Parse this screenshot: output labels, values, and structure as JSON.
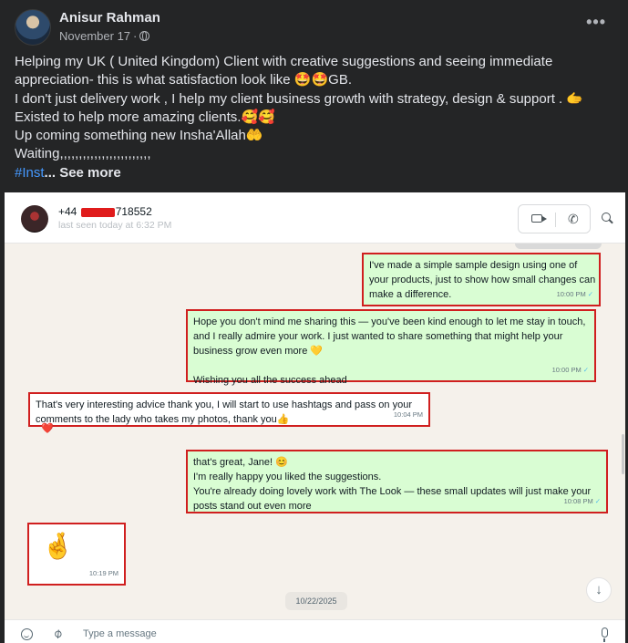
{
  "post": {
    "author": "Anisur Rahman",
    "date": "November 17",
    "separator": "·",
    "more_icon": "more-horizontal-icon",
    "privacy_icon": "globe-icon",
    "lines": [
      "Helping my UK ( United Kingdom) Client with creative suggestions and seeing immediate",
      "appreciation- this is what satisfaction look like 🤩🤩GB.",
      "I don't just delivery work , I help my client business growth with strategy, design & support . 🫱",
      "Existed to help more amazing clients.🥰🥰",
      "Up coming something new Insha'Allah🤲",
      "Waiting,,,,,,,,,,,,,,,,,,,,,,,,"
    ],
    "hashtag": "#Inst",
    "see_more": "... See more"
  },
  "chat": {
    "contact_prefix": "+44",
    "contact_suffix": "718552",
    "last_seen": "last seen today at 6:32 PM",
    "messages": [
      {
        "direction": "out",
        "lines": [
          "I've made a simple sample design using one of",
          "your products, just to show how small changes can",
          "make a difference."
        ],
        "time": "10:00 PM",
        "tick": "✓"
      },
      {
        "direction": "out",
        "lines": [
          "Hope you don't mind me sharing this — you've been kind enough to let me stay in touch,",
          "and I really admire your work. I just wanted to share something that might help your",
          "business grow even more 💛",
          "",
          "Wishing you all the success ahead"
        ],
        "time": "10:00 PM",
        "tick": "✓"
      },
      {
        "direction": "in",
        "lines": [
          "That's very interesting advice thank you, I will start to use hashtags and pass on your",
          "comments to the lady who takes my photos, thank you👍"
        ],
        "time": "10:04 PM",
        "tick": ""
      },
      {
        "direction": "out",
        "lines": [
          "that's great, Jane! 😊",
          "I'm really happy you liked the suggestions.",
          "You're already doing lovely work with The Look — these small updates will just make your",
          "posts stand out even more"
        ],
        "time": "10:08 PM",
        "tick": "✓"
      },
      {
        "direction": "in",
        "lines": [
          "🤞"
        ],
        "time": "10:19 PM",
        "tick": ""
      }
    ],
    "reaction": "❤️",
    "date_chip": "10/22/2025",
    "input_placeholder": "Type a message"
  },
  "colors": {
    "facebook_bg": "#242526",
    "outgoing_bubble": "#d9fdd3",
    "incoming_bubble": "#ffffff",
    "highlight_border": "#d01f1f",
    "hashtag": "#4599ff"
  }
}
